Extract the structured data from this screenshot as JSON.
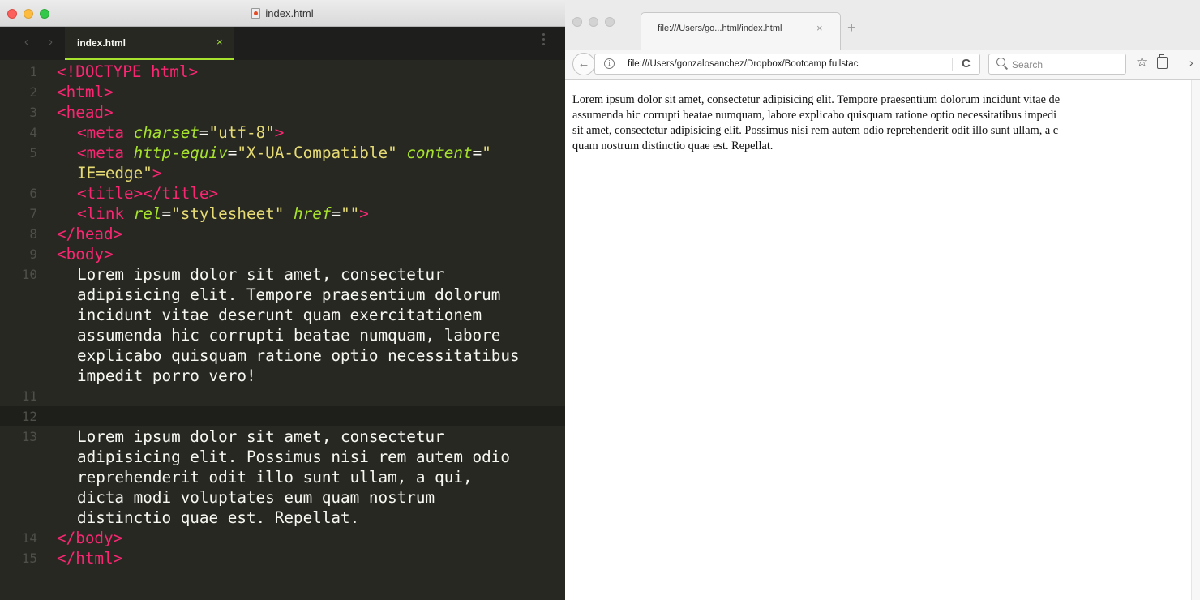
{
  "editor": {
    "window_title": "index.html",
    "tab_label": "index.html",
    "tab_close": "×",
    "nav_back": "‹",
    "nav_forward": "›",
    "lines": [
      {
        "num": "1",
        "html": "<span class=\"tag\">&lt;!DOCTYPE html&gt;</span>"
      },
      {
        "num": "2",
        "html": "<span class=\"tag\">&lt;html&gt;</span>"
      },
      {
        "num": "3",
        "html": "<span class=\"tag\">&lt;head&gt;</span>"
      },
      {
        "num": "4",
        "indent": true,
        "html": "<span class=\"tag\">&lt;meta</span> <span class=\"attr\">charset</span>=<span class=\"str\">\"utf-8\"</span><span class=\"tag\">&gt;</span>"
      },
      {
        "num": "5",
        "indent": true,
        "html": "<span class=\"tag\">&lt;meta</span> <span class=\"attr\">http-equiv</span>=<span class=\"str\">\"X-UA-Compatible\"</span> <span class=\"attr\">content</span>=<span class=\"str\">\"</span>"
      },
      {
        "num": "",
        "indent": true,
        "html": "<span class=\"str\">IE=edge\"</span><span class=\"tag\">&gt;</span>"
      },
      {
        "num": "6",
        "indent": true,
        "html": "<span class=\"tag\">&lt;title&gt;&lt;/title&gt;</span>"
      },
      {
        "num": "7",
        "indent": true,
        "html": "<span class=\"tag\">&lt;link</span> <span class=\"attr\">rel</span>=<span class=\"str\">\"stylesheet\"</span> <span class=\"attr\">href</span>=<span class=\"str\">\"\"</span><span class=\"tag\">&gt;</span>"
      },
      {
        "num": "8",
        "html": "<span class=\"tag\">&lt;/head&gt;</span>"
      },
      {
        "num": "9",
        "html": "<span class=\"tag\">&lt;body&gt;</span>"
      },
      {
        "num": "10",
        "indent": true,
        "html": "Lorem ipsum dolor sit amet, consectetur"
      },
      {
        "num": "",
        "indent": true,
        "html": "adipisicing elit. Tempore praesentium dolorum"
      },
      {
        "num": "",
        "indent": true,
        "html": "incidunt vitae deserunt quam exercitationem"
      },
      {
        "num": "",
        "indent": true,
        "html": "assumenda hic corrupti beatae numquam, labore"
      },
      {
        "num": "",
        "indent": true,
        "html": "explicabo quisquam ratione optio necessitatibus"
      },
      {
        "num": "",
        "indent": true,
        "html": "impedit porro vero!"
      },
      {
        "num": "11",
        "html": ""
      },
      {
        "num": "12",
        "html": "",
        "current": true
      },
      {
        "num": "13",
        "indent": true,
        "html": "Lorem ipsum dolor sit amet, consectetur"
      },
      {
        "num": "",
        "indent": true,
        "html": "adipisicing elit. Possimus nisi rem autem odio"
      },
      {
        "num": "",
        "indent": true,
        "html": "reprehenderit odit illo sunt ullam, a qui,"
      },
      {
        "num": "",
        "indent": true,
        "html": "dicta modi voluptates eum quam nostrum"
      },
      {
        "num": "",
        "indent": true,
        "html": "distinctio quae est. Repellat."
      },
      {
        "num": "14",
        "html": "<span class=\"tag\">&lt;/body&gt;</span>"
      },
      {
        "num": "15",
        "html": "<span class=\"tag\">&lt;/html&gt;</span>"
      }
    ]
  },
  "browser": {
    "tab_label": "file:///Users/go...html/index.html",
    "tab_close": "×",
    "new_tab": "+",
    "back": "←",
    "info": "i",
    "url": "file:///Users/gonzalosanchez/Dropbox/Bootcamp fullstac",
    "reload": "C",
    "search_placeholder": "Search",
    "star": "☆",
    "overflow": "›",
    "content_lines": [
      "Lorem ipsum dolor sit amet, consectetur adipisicing elit. Tempore praesentium dolorum incidunt vitae de",
      "assumenda hic corrupti beatae numquam, labore explicabo quisquam ratione optio necessitatibus impedi",
      "sit amet, consectetur adipisicing elit. Possimus nisi rem autem odio reprehenderit odit illo sunt ullam, a c",
      "quam nostrum distinctio quae est. Repellat."
    ]
  },
  "colors": {
    "editor_bg": "#272822",
    "tag": "#f92672",
    "attribute": "#a6e22e",
    "string": "#e6db74",
    "text": "#f8f8f2"
  }
}
